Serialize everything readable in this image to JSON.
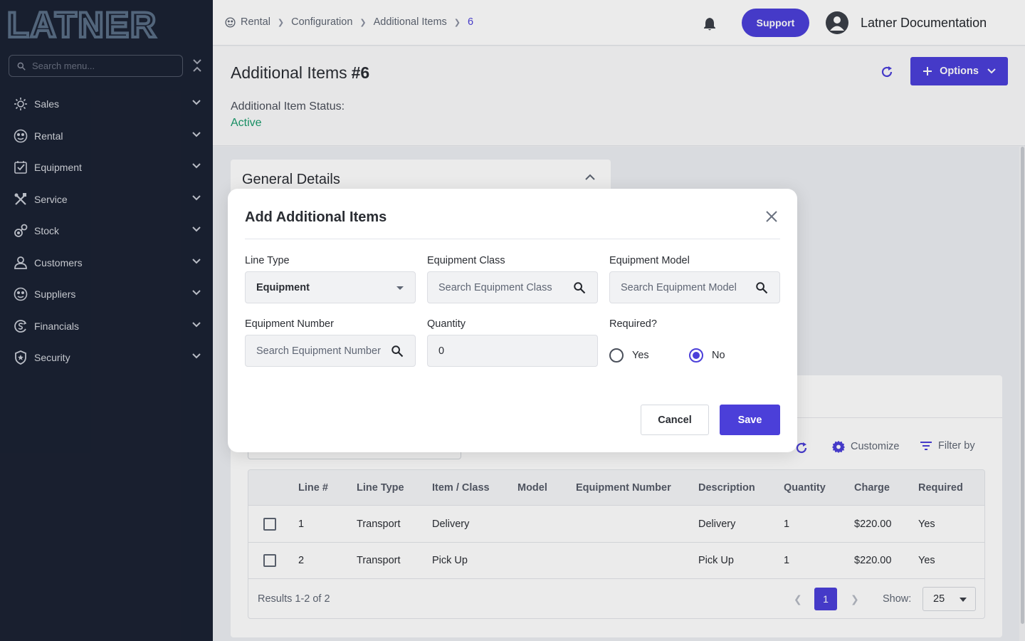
{
  "brand": {
    "logo_text": "LATNER",
    "accent": "#4b3fd9",
    "sidebar_bg": "#1b2233",
    "success": "#1a9b6c"
  },
  "sidebar": {
    "search_placeholder": "Search menu...",
    "items": [
      {
        "label": "Sales",
        "icon": "sales-icon"
      },
      {
        "label": "Rental",
        "icon": "rental-icon"
      },
      {
        "label": "Equipment",
        "icon": "equipment-icon"
      },
      {
        "label": "Service",
        "icon": "service-icon"
      },
      {
        "label": "Stock",
        "icon": "stock-icon"
      },
      {
        "label": "Customers",
        "icon": "customers-icon"
      },
      {
        "label": "Suppliers",
        "icon": "suppliers-icon"
      },
      {
        "label": "Financials",
        "icon": "financials-icon"
      },
      {
        "label": "Security",
        "icon": "security-icon"
      }
    ]
  },
  "topbar": {
    "breadcrumb": [
      "Rental",
      "Configuration",
      "Additional Items",
      "6"
    ],
    "support_label": "Support",
    "user_name": "Latner Documentation"
  },
  "page": {
    "title": "Additional Items",
    "title_id": "#6",
    "status_label": "Additional Item Status:",
    "status_value": "Active",
    "options_label": "Options"
  },
  "general_details": {
    "title": "General Details"
  },
  "table": {
    "customize_label": "Customize",
    "filter_label": "Filter by",
    "columns": [
      "Line #",
      "Line Type",
      "Item / Class",
      "Model",
      "Equipment Number",
      "Description",
      "Quantity",
      "Charge",
      "Required"
    ],
    "rows": [
      [
        "1",
        "Transport",
        "Delivery",
        "",
        "",
        "Delivery",
        "1",
        "$220.00",
        "Yes"
      ],
      [
        "2",
        "Transport",
        "Pick Up",
        "",
        "",
        "Pick Up",
        "1",
        "$220.00",
        "Yes"
      ]
    ],
    "results_text": "Results 1-2 of 2",
    "current_page": "1",
    "show_label": "Show:",
    "page_size": "25"
  },
  "modal": {
    "title": "Add Additional Items",
    "line_type_label": "Line Type",
    "line_type_value": "Equipment",
    "equipment_class_label": "Equipment Class",
    "equipment_class_placeholder": "Search Equipment Class",
    "equipment_model_label": "Equipment Model",
    "equipment_model_placeholder": "Search Equipment Model",
    "equipment_number_label": "Equipment Number",
    "equipment_number_placeholder": "Search Equipment Number",
    "quantity_label": "Quantity",
    "quantity_value": "0",
    "required_label": "Required?",
    "required_yes": "Yes",
    "required_no": "No",
    "required_selected": "No",
    "cancel_label": "Cancel",
    "save_label": "Save"
  }
}
